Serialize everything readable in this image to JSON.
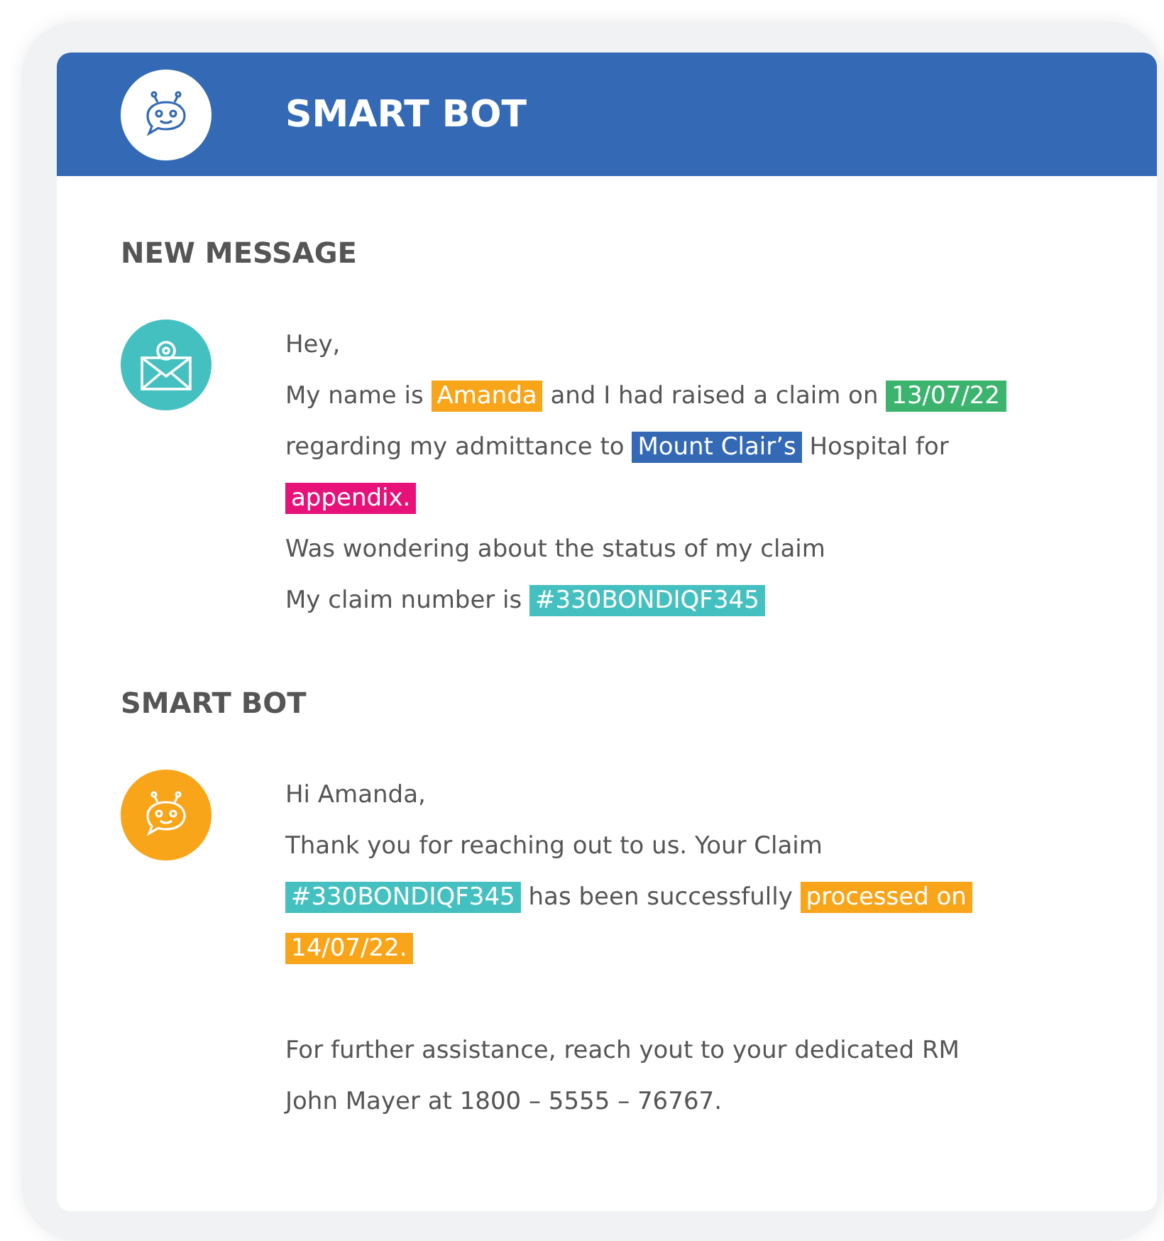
{
  "header": {
    "title": "SMART BOT"
  },
  "sections": [
    {
      "heading": "NEW MESSAGE",
      "kind": "mail",
      "color": "#45c0c0",
      "paragraphs": [
        [
          [
            {
              "text": "Hey,"
            }
          ],
          [
            {
              "text": "My name is "
            },
            {
              "text": "Amanda",
              "color": "#f9a51a"
            },
            {
              "text": " and I had raised a claim on "
            },
            {
              "text": "13/07/22",
              "color": "#3cb46e"
            }
          ],
          [
            {
              "text": "regarding my admittance to "
            },
            {
              "text": "Mount Clair’s",
              "color": "#3369b5"
            },
            {
              "text": " Hospital for"
            }
          ],
          [
            {
              "text": "appendix.",
              "color": "#e6127a"
            }
          ],
          [
            {
              "text": "Was wondering about the status of my claim"
            }
          ],
          [
            {
              "text": "My claim number is "
            },
            {
              "text": "#330BONDIQF345",
              "color": "#45c0c0"
            }
          ]
        ]
      ]
    },
    {
      "heading": "SMART BOT",
      "kind": "bot",
      "color": "#f9a51a",
      "paragraphs": [
        [
          [
            {
              "text": "Hi Amanda,"
            }
          ],
          [
            {
              "text": "Thank you for reaching out to us. Your Claim"
            }
          ],
          [
            {
              "text": "#330BONDIQF345",
              "color": "#45c0c0"
            },
            {
              "text": " has been successfully "
            },
            {
              "text": "processed on",
              "color": "#f9a51a"
            }
          ],
          [
            {
              "text": "14/07/22.",
              "color": "#f9a51a"
            }
          ]
        ],
        [
          [
            {
              "text": "For further assistance, reach yout to your dedicated RM"
            }
          ],
          [
            {
              "text": "John Mayer at 1800 – 5555 – 76767."
            }
          ]
        ]
      ]
    }
  ]
}
